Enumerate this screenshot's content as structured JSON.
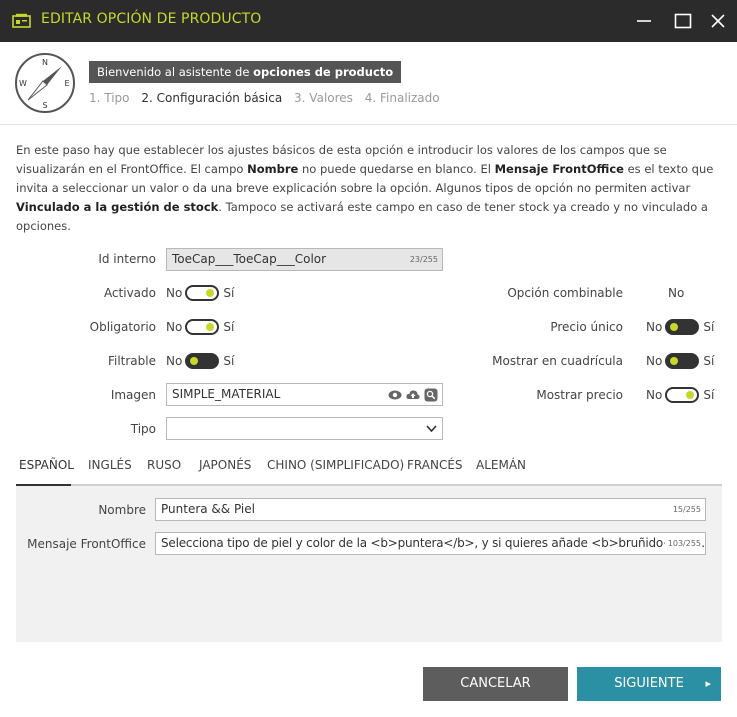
{
  "window": {
    "title": "EDITAR OPCIÓN DE PRODUCTO"
  },
  "wizard": {
    "welcome_prefix": "Bienvenido al asistente de ",
    "welcome_bold": "opciones de producto",
    "steps": [
      {
        "label": "1. Tipo"
      },
      {
        "label": "2. Configuración básica"
      },
      {
        "label": "3. Valores"
      },
      {
        "label": "4. Finalizado"
      }
    ],
    "active_step": 2,
    "compass": {
      "n": "N",
      "s": "S",
      "e": "E",
      "w": "W"
    }
  },
  "description": {
    "p1": "En este paso hay que establecer los ajustes básicos de esta opción e introducir los valores de los campos que se visualizarán en el FrontOffice. El campo ",
    "b1": "Nombre",
    "p2": " no puede quedarse en blanco. El ",
    "b2": "Mensaje FrontOffice",
    "p3": " es el texto que invita a seleccionar un valor o da una breve explicación sobre la opción. Algunos tipos de opción no permiten activar ",
    "b3": "Vinculado a la gestión de stock",
    "p4": ". Tampoco se activará este campo en caso de tener stock ya creado y no vinculado a opciones."
  },
  "form": {
    "id_interno": {
      "label": "Id interno",
      "value": "ToeCap___ToeCap___Color",
      "counter": "23/255"
    },
    "activado": {
      "label": "Activado",
      "no": "No",
      "si": "Sí",
      "on": true
    },
    "obligatorio": {
      "label": "Obligatorio",
      "no": "No",
      "si": "Sí",
      "on": true
    },
    "filtrable": {
      "label": "Filtrable",
      "no": "No",
      "si": "Sí",
      "on": false
    },
    "imagen": {
      "label": "Imagen",
      "value": "SIMPLE_MATERIAL",
      "icons": [
        "eye-icon",
        "cloud-upload-icon",
        "search-icon"
      ]
    },
    "tipo": {
      "label": "Tipo",
      "value": ""
    },
    "opcion_combinable": {
      "label": "Opción combinable",
      "value": "No"
    },
    "precio_unico": {
      "label": "Precio único",
      "no": "No",
      "si": "Sí",
      "on": false
    },
    "mostrar_cuadricula": {
      "label": "Mostrar en cuadrícula",
      "no": "No",
      "si": "Sí",
      "on": false
    },
    "mostrar_precio": {
      "label": "Mostrar precio",
      "no": "No",
      "si": "Sí",
      "on": true
    }
  },
  "language_tabs": [
    {
      "label": "ESPAÑOL"
    },
    {
      "label": "INGLÉS"
    },
    {
      "label": "RUSO"
    },
    {
      "label": "JAPONÉS"
    },
    {
      "label": "CHINO (SIMPLIFICADO)"
    },
    {
      "label": "FRANCÉS"
    },
    {
      "label": "ALEMÁN"
    }
  ],
  "active_tab": 0,
  "lang_fields": {
    "nombre": {
      "label": "Nombre",
      "value": "Puntera && Piel",
      "counter": "15/255"
    },
    "mensaje": {
      "label": "Mensaje FrontOffice",
      "value": "Selecciona tipo de piel y color de la <b>puntera</b>, y si quieres añade <b>bruñido</b> ...",
      "counter": "103/255"
    }
  },
  "buttons": {
    "cancel": "CANCELAR",
    "next": "SIGUIENTE"
  },
  "colors": {
    "accent": "#c6d82a",
    "titlebar": "#2b2b2b",
    "primary": "#2c90a5",
    "secondary": "#5d5d5d"
  }
}
